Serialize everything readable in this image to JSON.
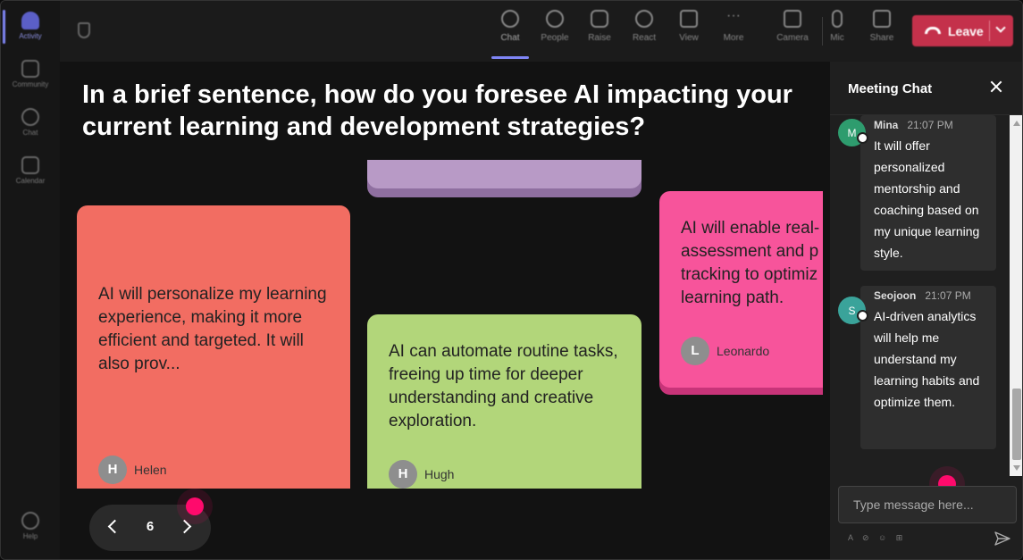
{
  "rail": {
    "items": [
      {
        "label": "Activity",
        "active": true
      },
      {
        "label": "Community"
      },
      {
        "label": "Chat"
      },
      {
        "label": "Calendar"
      },
      {
        "label": "Help"
      }
    ]
  },
  "toolbar": {
    "items": [
      {
        "label": "Chat",
        "icon": "chat-icon",
        "active": true
      },
      {
        "label": "People",
        "icon": "people-icon"
      },
      {
        "label": "Raise",
        "icon": "raise-hand-icon"
      },
      {
        "label": "React",
        "icon": "react-icon"
      },
      {
        "label": "View",
        "icon": "view-icon"
      },
      {
        "label": "More",
        "icon": "more-icon"
      },
      {
        "label": "Camera",
        "icon": "camera-icon"
      },
      {
        "label": "Mic",
        "icon": "mic-icon"
      },
      {
        "label": "Share",
        "icon": "share-icon"
      }
    ],
    "leave_label": "Leave"
  },
  "main": {
    "question": "In a brief sentence, how do you foresee AI impacting your current learning and development strategies?",
    "cards": [
      {
        "text": "AI will personalize my learning experience, making it more efficient and targeted. It will also prov...",
        "author": "Helen",
        "initial": "H",
        "color": "#f26d62"
      },
      {
        "text": "AI can automate routine tasks, freeing up time for deeper understanding and creative exploration.",
        "author": "Hugh",
        "initial": "H",
        "color": "#b2d67a"
      },
      {
        "text": "AI will enable real-time assessment and progress tracking to optimize my learning path.",
        "visible_text": "AI will enable real-\nassessment and p\ntracking to optimiz\nlearning path.",
        "author": "Leonardo",
        "initial": "L",
        "color": "#f7549b"
      }
    ],
    "pager": {
      "page": "6"
    }
  },
  "chat": {
    "title": "Meeting Chat",
    "messages": [
      {
        "name": "Mina",
        "initial": "M",
        "time": "21:07 PM",
        "text": "It will offer personalized mentorship and coaching based on my unique learning style.",
        "avatar_color": "#2e9c6e"
      },
      {
        "name": "Seojoon",
        "initial": "S",
        "time": "21:07 PM",
        "text": "AI-driven analytics will help me understand my learning habits and optimize them.",
        "avatar_color": "#3aa39a"
      }
    ],
    "input_placeholder": "Type message here..."
  },
  "colors": {
    "accent": "#7f85f5",
    "leave": "#c4314b",
    "cursor": "#ff0a6c"
  }
}
